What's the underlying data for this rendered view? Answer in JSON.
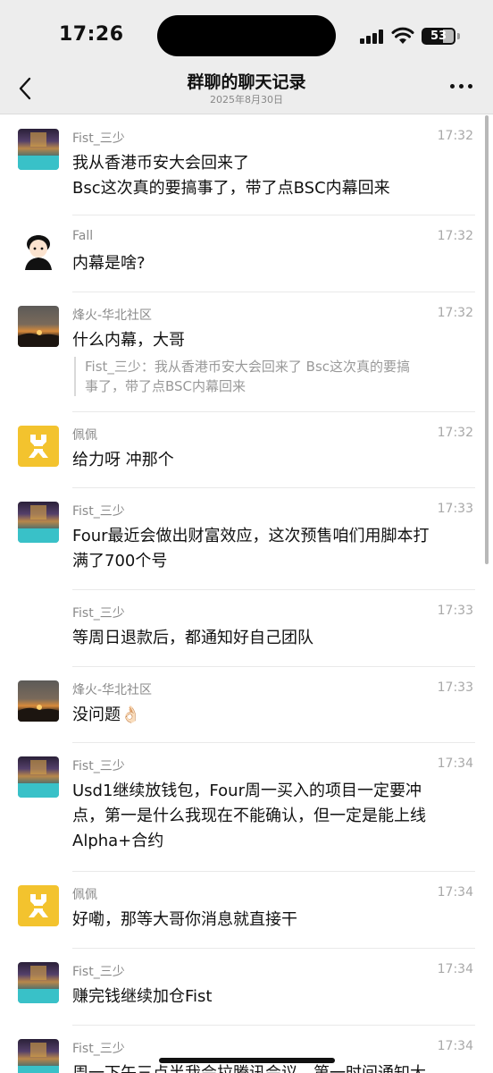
{
  "status": {
    "time": "17:26",
    "battery": "53"
  },
  "nav": {
    "title": "群聊的聊天记录",
    "date": "2025年8月30日"
  },
  "messages": [
    {
      "name": "Fist_三少",
      "time": "17:32",
      "lines": [
        "我从香港币安大会回来了",
        "Bsc这次真的要搞事了，带了点BSC内幕回来"
      ],
      "avatar": "fist"
    },
    {
      "name": "Fall",
      "time": "17:32",
      "lines": [
        "内幕是啥?"
      ],
      "avatar": "fall"
    },
    {
      "name": "烽火-华北社区",
      "time": "17:32",
      "lines": [
        "什么内幕，大哥"
      ],
      "quote": [
        "Fist_三少：我从香港币安大会回来了 Bsc这次真的要搞",
        "事了，带了点BSC内幕回来"
      ],
      "avatar": "fire"
    },
    {
      "name": "佩佩",
      "time": "17:32",
      "lines": [
        "给力呀 冲那个"
      ],
      "avatar": "pei"
    },
    {
      "name": "Fist_三少",
      "time": "17:33",
      "lines": [
        "Four最近会做出财富效应，这次预售咱们用脚本打",
        "满了700个号"
      ],
      "avatar": "fist"
    },
    {
      "name": "Fist_三少",
      "time": "17:33",
      "lines": [
        "等周日退款后，都通知好自己团队"
      ],
      "avatar": "none"
    },
    {
      "name": "烽火-华北社区",
      "time": "17:33",
      "lines": [
        "没问题👌🏻"
      ],
      "avatar": "fire"
    },
    {
      "name": "Fist_三少",
      "time": "17:34",
      "lines": [
        "Usd1继续放钱包，Four周一买入的项目一定要冲",
        "点，第一是什么我现在不能确认，但一定是能上线",
        "Alpha+合约"
      ],
      "avatar": "fist"
    },
    {
      "name": "佩佩",
      "time": "17:34",
      "lines": [
        "好嘞，那等大哥你消息就直接干"
      ],
      "avatar": "pei"
    },
    {
      "name": "Fist_三少",
      "time": "17:34",
      "lines": [
        "赚完钱继续加仓Fist"
      ],
      "avatar": "fist"
    },
    {
      "name": "Fist_三少",
      "time": "17:34",
      "lines": [
        "周一下午三点半我会拉腾讯会议，第一时间通知大"
      ],
      "avatar": "fist"
    }
  ]
}
